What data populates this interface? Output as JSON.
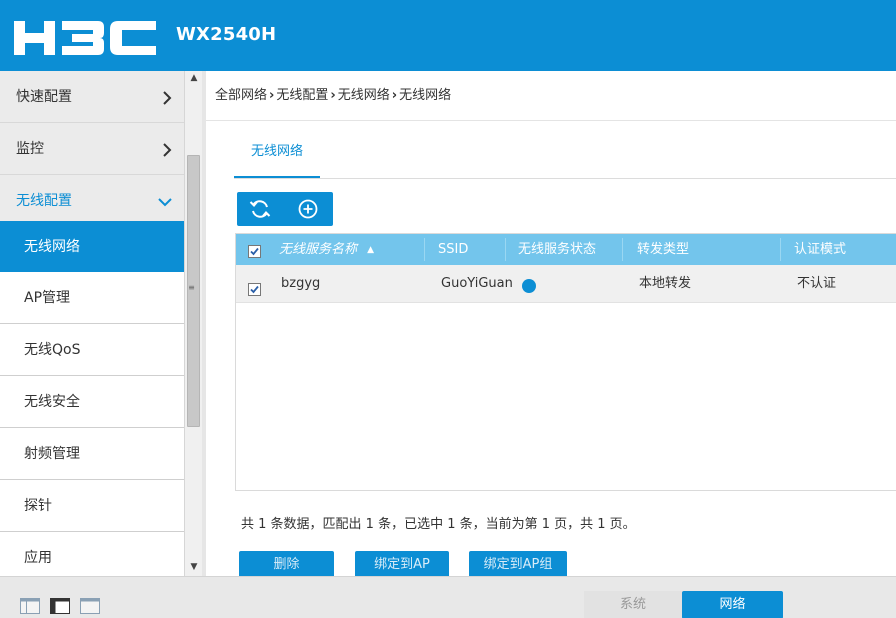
{
  "header": {
    "model": "WX2540H"
  },
  "sidebar": {
    "top_items": [
      {
        "label": "快速配置",
        "chevron": "›"
      },
      {
        "label": "监控",
        "chevron": "›"
      },
      {
        "label": "无线配置",
        "chevron": "⌄"
      }
    ],
    "sub_items": [
      {
        "label": "无线网络",
        "active": true
      },
      {
        "label": "AP管理"
      },
      {
        "label": "无线QoS"
      },
      {
        "label": "无线安全"
      },
      {
        "label": "射频管理"
      },
      {
        "label": "探针"
      },
      {
        "label": "应用"
      }
    ]
  },
  "breadcrumb": [
    "全部网络",
    "无线配置",
    "无线网络",
    "无线网络"
  ],
  "tab": {
    "label": "无线网络"
  },
  "table": {
    "columns": [
      "无线服务名称",
      "SSID",
      "无线服务状态",
      "转发类型",
      "认证模式"
    ],
    "rows": [
      {
        "name": "bzgyg",
        "ssid": "GuoYiGuan",
        "status": "enabled",
        "forward": "本地转发",
        "auth": "不认证"
      }
    ]
  },
  "summary": "共 1 条数据，匹配出 1 条，已选中 1 条，当前为第 1 页，共 1 页。",
  "actions": {
    "delete": "删除",
    "bind_ap": "绑定到AP",
    "bind_ap_group": "绑定到AP组"
  },
  "footer": {
    "system": "系统",
    "network": "网络"
  },
  "colors": {
    "primary": "#0c8ed4",
    "table_header": "#73c5ec"
  }
}
